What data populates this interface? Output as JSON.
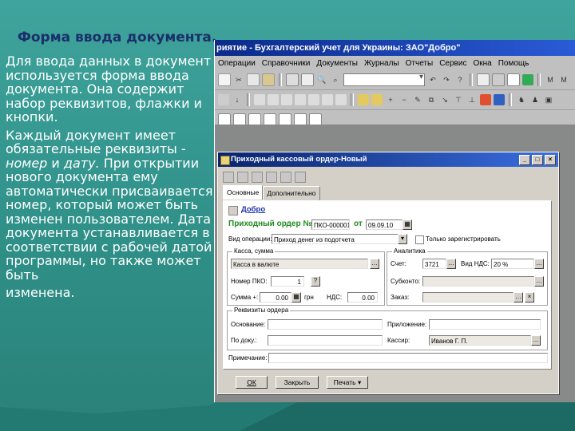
{
  "slide": {
    "title": "Форма ввода документа.",
    "para1": "Для ввода данных в документ используется форма ввода документа. Она содержит набор реквизитов, флажки и кнопки.",
    "para2_start": "Каждый документ имеет обязательные реквизиты -",
    "para2_num": "номер",
    "para2_and": " и ",
    "para2_date": "дату.",
    "para2_end": " При открытии нового документа ему автоматически присваивается номер, который может быть изменен пользователем. Дата документа устанавливается в соответствии с рабочей датой программы, но также может быть",
    "para2_last": "изменена."
  },
  "app": {
    "title": "риятие - Бухгалтерский учет для Украины: ЗАО\"Добро\"",
    "menu": [
      "Операции",
      "Справочники",
      "Документы",
      "Журналы",
      "Отчеты",
      "Сервис",
      "Окна",
      "Помощь"
    ]
  },
  "dialog": {
    "title": "Приходный кассовый ордер-Новый",
    "tab_main": "Основные",
    "tab_extra": "Дополнительно",
    "org": "Добро",
    "order_label": "Приходный ордер №",
    "order_number": "ПКО-000001",
    "date_label": "от",
    "date_value": "09.09.10",
    "op_label": "Вид операции:",
    "op_value": "Приход денег из подотчета",
    "only_register": "Только зарегистрировать",
    "cash_group": "Касса, сумма",
    "cash_value": "Касса в валюте",
    "num_pko_label": "Номер ПКО:",
    "num_pko_value": "1",
    "q_btn": "?",
    "sum_label": "Сумма +:",
    "sum_value": "0.00",
    "currency": "грн",
    "vat_label": "НДС:",
    "vat_value": "0.00",
    "analytics_group": "Аналитика",
    "account_label": "Счет:",
    "account_value": "3721",
    "vat_type_label": "Вид НДС:",
    "vat_type_value": "20 %",
    "subconto_label": "Субконто:",
    "order_req_label": "Заказ:",
    "props_group": "Реквизиты ордера",
    "basis_label": "Основание:",
    "attach_label": "Приложение:",
    "from_label": "По доку.:",
    "cashier_label": "Кассир:",
    "cashier_value": "Иванов Г. П.",
    "note_label": "Примечание:",
    "ok": "ОК",
    "close": "Закрыть",
    "print": "Печать"
  },
  "colors": {
    "background": "#3fa49d",
    "title": "#1b2f6b",
    "titlebar": "#0b2a8a",
    "green_label": "#1e8a1e"
  }
}
